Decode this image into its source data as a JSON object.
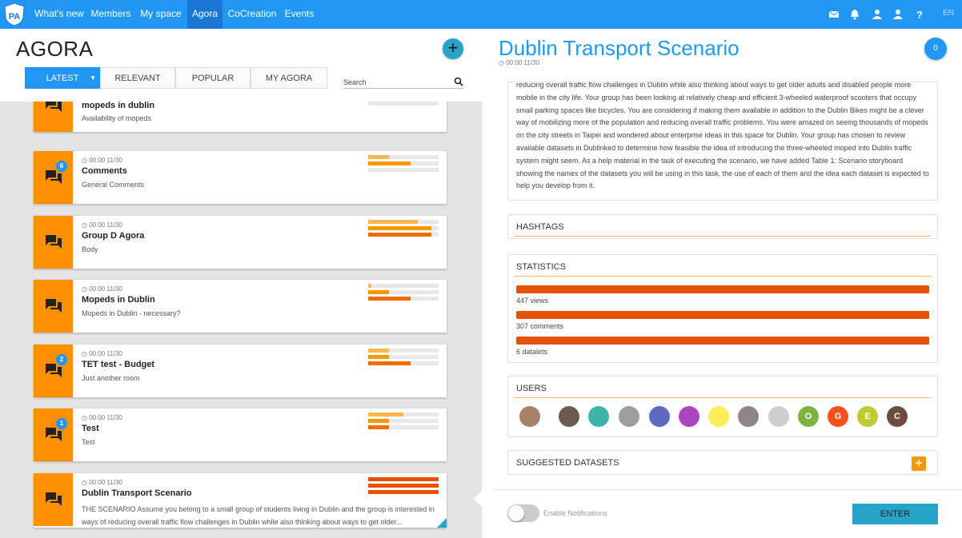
{
  "nav": {
    "logo_text": "PA",
    "items": [
      "What's new",
      "Members",
      "My space",
      "Agora",
      "CoCreation",
      "Events"
    ],
    "active": "Agora",
    "lang": "EN"
  },
  "agora": {
    "title": "AGORA",
    "add_label": "+",
    "tabs": [
      "LATEST",
      "RELEVANT",
      "POPULAR",
      "MY AGORA"
    ],
    "search_placeholder": "Search"
  },
  "cards": [
    {
      "time": "",
      "title": "mopeds in dublin",
      "sub": "Availability of mopeds",
      "badge": "",
      "bars": [
        0,
        0,
        0
      ]
    },
    {
      "time": "00:00 11/30",
      "title": "Comments",
      "sub": "General Comments",
      "badge": "6",
      "bars": [
        0.3,
        0.6,
        0
      ]
    },
    {
      "time": "00:00 11/30",
      "title": "Group D Agora",
      "sub": "Body",
      "badge": "",
      "bars": [
        0.7,
        0.9,
        0.9
      ]
    },
    {
      "time": "00:00 11/30",
      "title": "Mopeds in Dublin",
      "sub": "Mopeds in Dublin - necessary?",
      "badge": "",
      "bars": [
        0.05,
        0.3,
        0.6
      ]
    },
    {
      "time": "00:00 11/30",
      "title": "TET test - Budget",
      "sub": "Just another room",
      "badge": "2",
      "bars": [
        0.3,
        0.3,
        0.6
      ]
    },
    {
      "time": "00:00 11/30",
      "title": "Test",
      "sub": "Test",
      "badge": "1",
      "bars": [
        0.5,
        0.3,
        0.3
      ]
    },
    {
      "time": "00:00 11/30",
      "title": "Dublin Transport Scenario",
      "sub": "THE SCENARIO Assume you belong to a small group of students living in Dublin and the group is interested in ways of reducing overall traffic flow challenges in Dublin while also thinking about ways to get older...",
      "badge": "",
      "bars": [
        1,
        1,
        1
      ]
    }
  ],
  "scenario": {
    "title": "Dublin Transport Scenario",
    "time": "00:00 11/30",
    "count": "0",
    "description": "reducing overall traffic flow challenges in Dublin while also thinking about ways to get older adults and disabled people more mobile in the city life. Your group has been looking at relatively cheap and efficient 3-wheeled waterproof scooters that occupy small parking spaces like bicycles. You are considering if making them available in addition to the Dublin Bikes might be a clever way of mobilizing more of the population and reducing overall traffic problems. You were amazed on seeing thousands of mopeds on the city streets in Taipei and wondered about enterprise ideas in this space for Dublin. Your group has chosen to review available datasets in Dublinked to determine how feasible the idea of introducing the three-wheeled moped into Dublin traffic system might seem. As a help material in the task of executing the scenario, we have added Table 1: Scenario storyboard showing the names of the datasets you will be using in this task, the use of each of them and the idea each dataset is expected to help you develop from it.",
    "hashtags_title": "HASHTAGS",
    "statistics_title": "STATISTICS",
    "stats": [
      "447 views",
      "307 comments",
      "6 datalets"
    ],
    "users_title": "USERS",
    "letter_avatars": [
      "O",
      "G",
      "E",
      "C"
    ],
    "datasets_title": "SUGGESTED DATASETS",
    "datasets_add": "+",
    "notifications_label": "Enable Notifications",
    "enter_label": "ENTER"
  },
  "colors": {
    "primary": "#2196f3",
    "accent_orange": "#ff8f00",
    "stat_bar": "#e65100",
    "teal": "#26a5c9"
  }
}
